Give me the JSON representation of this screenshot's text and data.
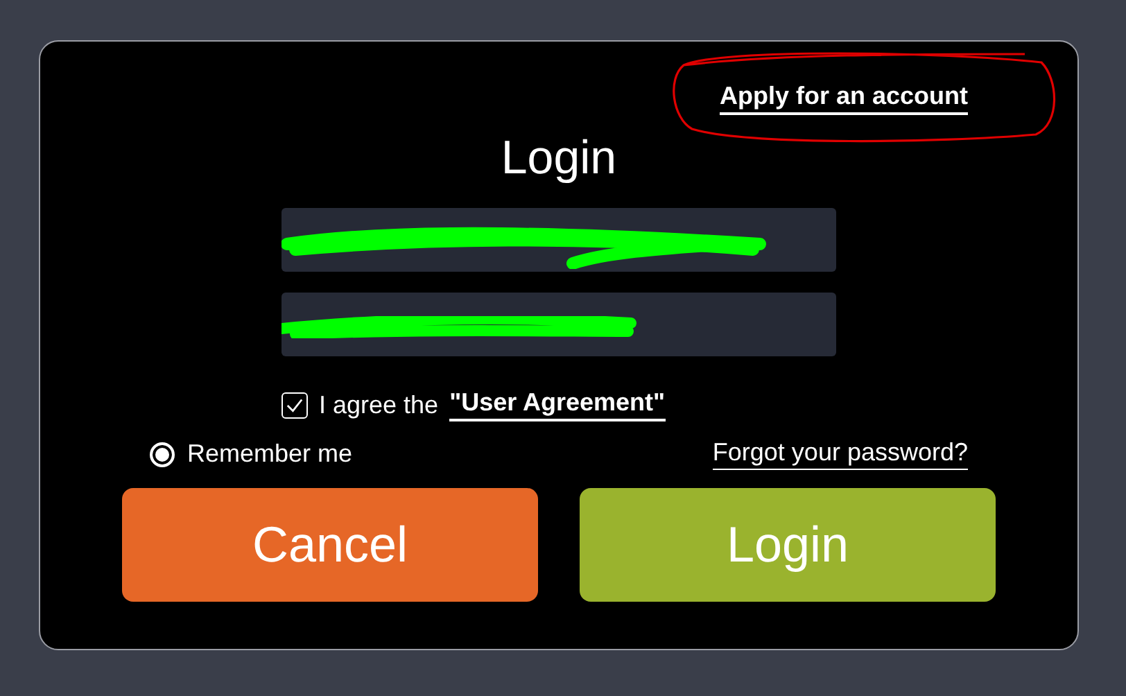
{
  "dialog": {
    "apply_link": "Apply for an account",
    "apply_link_circled": true,
    "title": "Login",
    "fields": [
      {
        "redacted": true
      },
      {
        "redacted": true
      }
    ],
    "agreement": {
      "checked": true,
      "label": "I agree the",
      "link": "\"User Agreement\""
    },
    "remember": {
      "selected": true,
      "label": "Remember me"
    },
    "forgot_link": "Forgot your password?",
    "buttons": [
      {
        "kind": "cancel",
        "label": "Cancel"
      },
      {
        "kind": "confirm",
        "label": "Login"
      }
    ]
  }
}
